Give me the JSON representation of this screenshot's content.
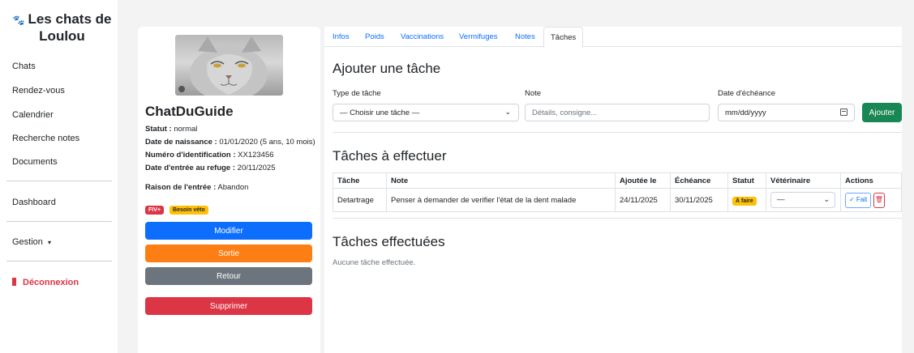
{
  "sidebar": {
    "title": "Les chats de Loulou",
    "items": [
      {
        "label": "Chats"
      },
      {
        "label": "Rendez-vous"
      },
      {
        "label": "Calendrier"
      },
      {
        "label": "Recherche notes"
      },
      {
        "label": "Documents"
      }
    ],
    "dashboard": "Dashboard",
    "gestion": "Gestion",
    "gestion_caret": "▾",
    "logout": "Déconnexion"
  },
  "cat": {
    "name": "ChatDuGuide",
    "status_label": "Statut :",
    "status_value": "normal",
    "birth_label": "Date de naissance :",
    "birth_value": "01/01/2020 (5 ans, 10 mois)",
    "id_label": "Numéro d'identification :",
    "id_value": "XX123456",
    "entry_label": "Date d'entrée au refuge :",
    "entry_value": "20/11/2025",
    "reason_label": "Raison de l'entrée :",
    "reason_value": "Abandon",
    "badges": {
      "fiv": "FIV+",
      "veto": "Besoin véto"
    },
    "buttons": {
      "modify": "Modifier",
      "exit": "Sortie",
      "back": "Retour",
      "delete": "Supprimer"
    }
  },
  "tabs": [
    {
      "label": "Infos"
    },
    {
      "label": "Poids"
    },
    {
      "label": "Vaccinations"
    },
    {
      "label": "Vermifuges"
    },
    {
      "label": "Notes"
    },
    {
      "label": "Tâches"
    }
  ],
  "add_task": {
    "heading": "Ajouter une tâche",
    "type_label": "Type de tâche",
    "type_value": "— Choisir une tâche —",
    "note_label": "Note",
    "note_placeholder": "Détails, consigne...",
    "due_label": "Date d'échéance",
    "due_placeholder": "mm/dd/yyyy",
    "submit": "Ajouter"
  },
  "todo": {
    "heading": "Tâches à effectuer",
    "columns": [
      "Tâche",
      "Note",
      "Ajoutée le",
      "Échéance",
      "Statut",
      "Vétérinaire",
      "Actions"
    ],
    "rows": [
      {
        "task": "Detartrage",
        "note": "Penser à demander de verifier l'état de la dent malade",
        "added": "24/11/2025",
        "due": "30/11/2025",
        "status": "À faire",
        "vet": "—",
        "done_label": "✓ Fait",
        "delete_icon": "🗑"
      }
    ]
  },
  "done": {
    "heading": "Tâches effectuées",
    "empty": "Aucune tâche effectuée."
  },
  "colors": {
    "primary": "#0d6efd",
    "orange": "#fd7e14",
    "secondary": "#6c757d",
    "danger": "#dc3545",
    "success": "#198754",
    "warning": "#ffc107"
  }
}
